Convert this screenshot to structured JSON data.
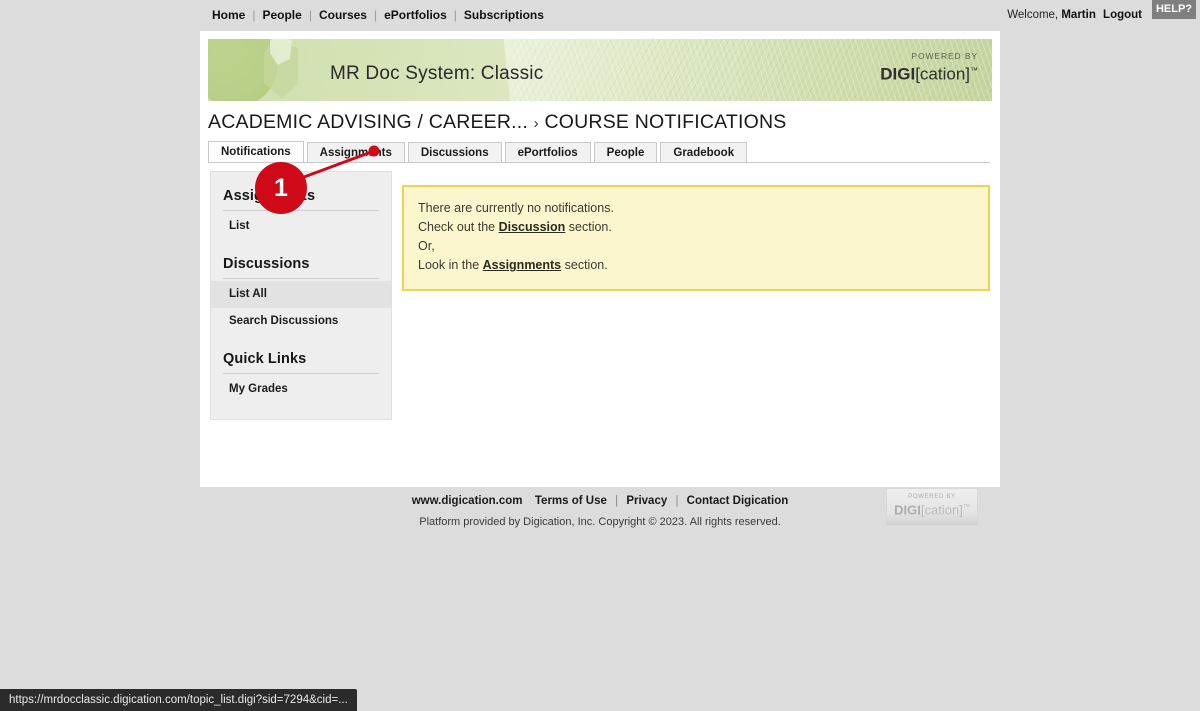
{
  "topnav": {
    "links": [
      "Home",
      "People",
      "Courses",
      "ePortfolios",
      "Subscriptions"
    ],
    "welcome_label": "Welcome,",
    "username": "Martin",
    "logout_label": "Logout",
    "help_label": "HELP?"
  },
  "banner": {
    "title": "MR Doc System: Classic",
    "powered_by": "POWERED BY",
    "logo_bold": "DIGI",
    "logo_rest": "[cation]",
    "logo_tm": "™"
  },
  "breadcrumb": {
    "parent": "ACADEMIC ADVISING / CAREER...",
    "separator": "›",
    "current": "COURSE NOTIFICATIONS"
  },
  "tabs": [
    {
      "label": "Notifications",
      "active": true
    },
    {
      "label": "Assignments",
      "active": false
    },
    {
      "label": "Discussions",
      "active": false
    },
    {
      "label": "ePortfolios",
      "active": false
    },
    {
      "label": "People",
      "active": false
    },
    {
      "label": "Gradebook",
      "active": false
    }
  ],
  "sidebar": {
    "sections": [
      {
        "heading": "Assignments",
        "items": [
          {
            "label": "List",
            "selected": false
          }
        ]
      },
      {
        "heading": "Discussions",
        "items": [
          {
            "label": "List All",
            "selected": true
          },
          {
            "label": "Search Discussions",
            "selected": false
          }
        ]
      },
      {
        "heading": "Quick Links",
        "items": [
          {
            "label": "My Grades",
            "selected": false
          }
        ]
      }
    ]
  },
  "notice": {
    "line1": "There are currently no notifications.",
    "line2_before": "Check out the ",
    "line2_link": "Discussion",
    "line2_after": " section.",
    "line3": "Or,",
    "line4_before": "Look in the ",
    "line4_link": "Assignments",
    "line4_after": " section."
  },
  "footer": {
    "site": "www.digication.com",
    "terms": "Terms of Use",
    "privacy": "Privacy",
    "contact": "Contact Digication",
    "copyright": "Platform provided by Digication, Inc. Copyright © 2023. All rights reserved.",
    "badge_powered_by": "POWERED BY",
    "badge_logo_bold": "DIGI",
    "badge_logo_rest": "[cation]",
    "badge_logo_tm": "™"
  },
  "annotation": {
    "step_number": "1",
    "color": "#ce0a18",
    "target_tab": "Assignments"
  },
  "statusbar": {
    "url": "https://mrdocclassic.digication.com/topic_list.digi?sid=7294&cid=..."
  },
  "colors": {
    "page_background": "#dcdcdc",
    "panel": "#ffffff",
    "sidebar": "#eeeeee",
    "notice_bg": "#fcf6cf",
    "notice_border": "#f2d14f",
    "banner_green": "#d4e2b5",
    "annotation_red": "#ce0a18",
    "statusbar_bg": "#2b2b2b"
  }
}
